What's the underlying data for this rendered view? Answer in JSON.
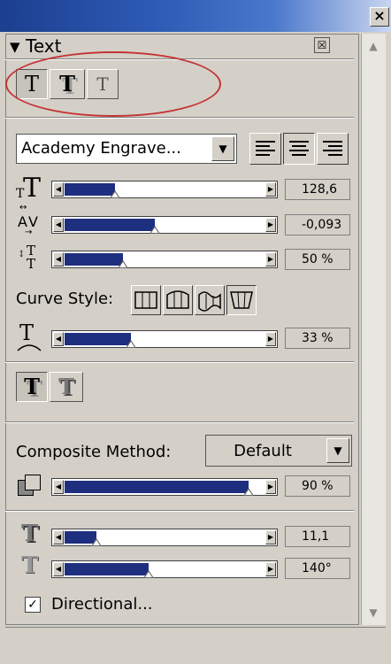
{
  "window": {
    "close_glyph": "×"
  },
  "panel": {
    "title": "Text",
    "collapse_glyph": "▼",
    "close_glyph": "☒"
  },
  "style_buttons": [
    "T",
    "T",
    "T"
  ],
  "font": {
    "value": "Academy Engrave..."
  },
  "align": [
    "align-left",
    "align-center",
    "align-right"
  ],
  "sliders": {
    "size": {
      "value": "128,6",
      "level": 0.25
    },
    "tracking": {
      "value": "-0,093",
      "level": 0.45
    },
    "spacing": {
      "value": "50 %",
      "level": 0.29
    },
    "curve_amount": {
      "value": "33 %",
      "level": 0.33
    },
    "opacity": {
      "value": "90 %",
      "level": 0.92
    },
    "depth": {
      "value": "11,1",
      "level": 0.16
    },
    "angle": {
      "value": "140°",
      "level": 0.42
    }
  },
  "curve_style": {
    "label": "Curve Style:"
  },
  "composite": {
    "label": "Composite Method:",
    "value": "Default"
  },
  "directional": {
    "label": "Directional...",
    "checked": true,
    "check_glyph": "✓"
  },
  "colors": {
    "slider_fill": "#1f2f7f",
    "highlight_oval": "#c43333",
    "title_bar": "#1c3f8f"
  }
}
